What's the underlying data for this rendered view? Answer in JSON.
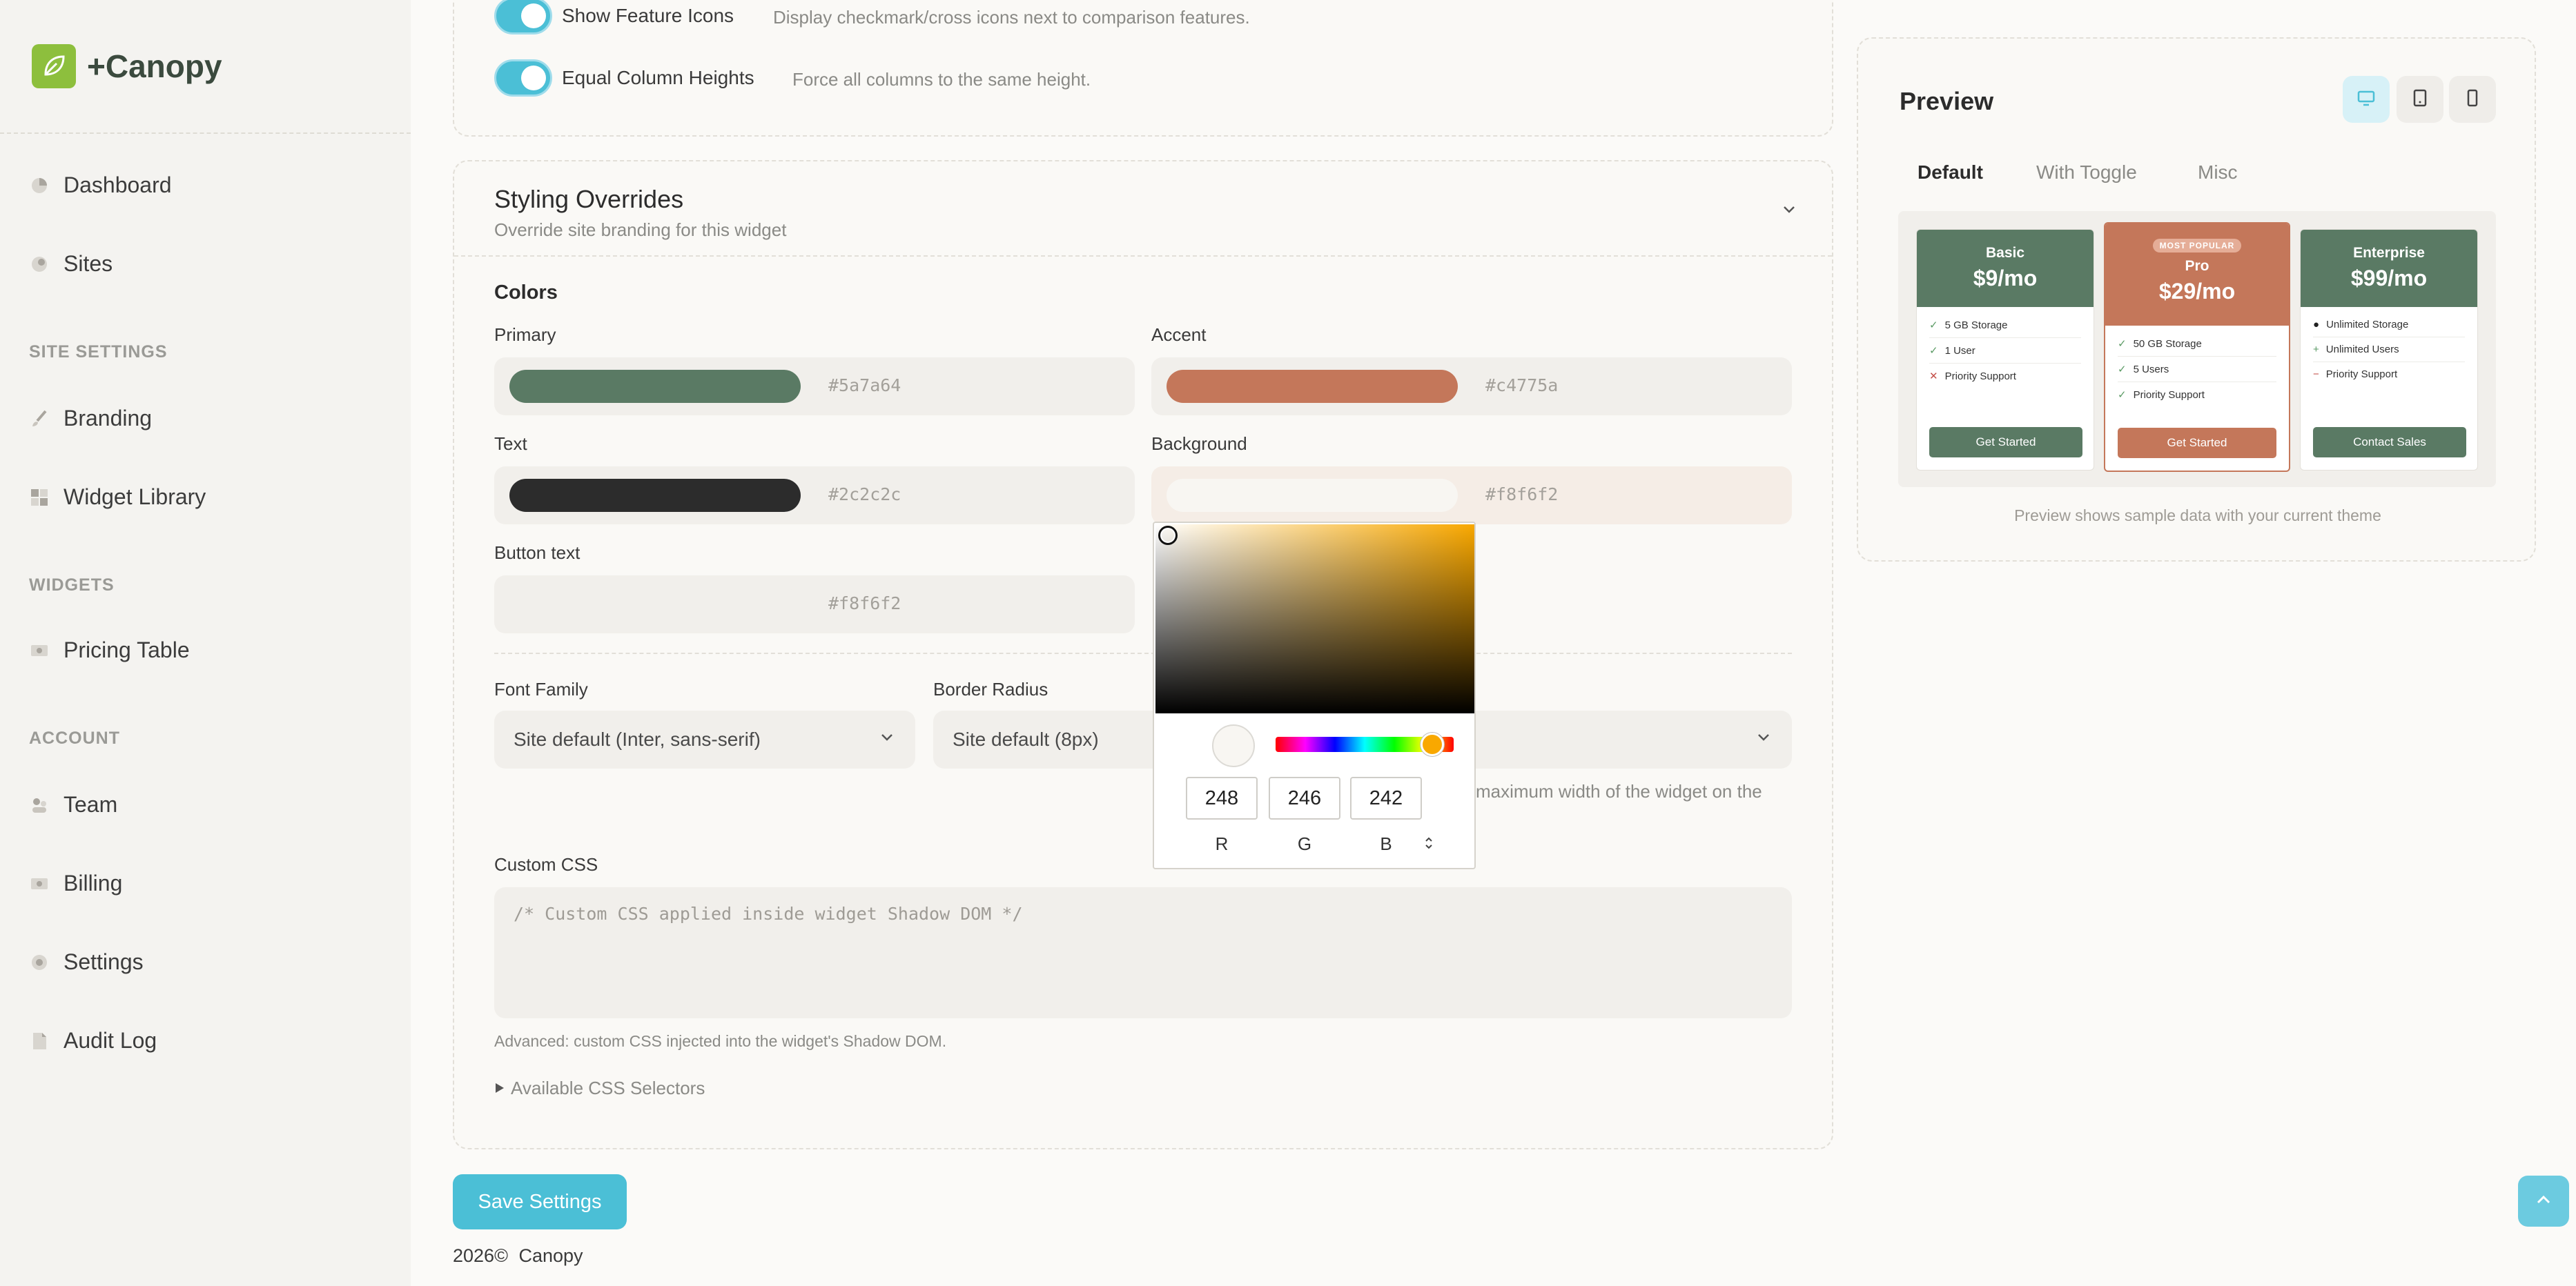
{
  "app": {
    "name": "+Canopy"
  },
  "sidebar": {
    "items": [
      {
        "label": "Dashboard"
      },
      {
        "label": "Sites"
      },
      {
        "label": "Branding"
      },
      {
        "label": "Widget Library"
      },
      {
        "label": "Pricing Table"
      },
      {
        "label": "Team"
      },
      {
        "label": "Billing"
      },
      {
        "label": "Settings"
      },
      {
        "label": "Audit Log"
      }
    ],
    "sections": [
      "SITE SETTINGS",
      "WIDGETS",
      "ACCOUNT"
    ]
  },
  "display_options": {
    "show_feature_icons": {
      "label": "Show Feature Icons",
      "desc": "Display checkmark/cross icons next to comparison features.",
      "on": true
    },
    "equal_column_heights": {
      "label": "Equal Column Heights",
      "desc": "Force all columns to the same height.",
      "on": true
    }
  },
  "styling": {
    "title": "Styling Overrides",
    "subtitle": "Override site branding for this widget",
    "colors_heading": "Colors",
    "primary": {
      "label": "Primary",
      "hex": "#5a7a64",
      "color": "#5a7a64"
    },
    "accent": {
      "label": "Accent",
      "hex": "#c4775a",
      "color": "#c4775a"
    },
    "text": {
      "label": "Text",
      "hex": "#2c2c2c",
      "color": "#2c2c2c"
    },
    "background": {
      "label": "Background",
      "hex": "#f8f6f2",
      "color": "#f8f6f2"
    },
    "button_text": {
      "label": "Button text",
      "hex": "#f8f6f2"
    },
    "font_family": {
      "label": "Font Family",
      "value": "Site default (Inter, sans-serif)"
    },
    "border_radius": {
      "label": "Border Radius",
      "value": "Site default (8px)"
    },
    "max_width_help": "maximum width of the widget on the",
    "custom_css": {
      "label": "Custom CSS",
      "placeholder": "/* Custom CSS applied inside widget Shadow DOM */",
      "help": "Advanced: custom CSS injected into the widget's Shadow DOM."
    },
    "css_selectors": "Available CSS Selectors"
  },
  "color_picker": {
    "r": "248",
    "g": "246",
    "b": "242",
    "r_label": "R",
    "g_label": "G",
    "b_label": "B"
  },
  "save_button": "Save Settings",
  "footer": {
    "year": "2026©",
    "name": "Canopy"
  },
  "preview": {
    "title": "Preview",
    "tabs": [
      "Default",
      "With Toggle",
      "Misc"
    ],
    "caption": "Preview shows sample data with your current theme",
    "plans": [
      {
        "name": "Basic",
        "price": "$9/mo",
        "features": [
          "5 GB Storage",
          "1 User",
          "Priority Support"
        ],
        "feature_icons": [
          "check",
          "check",
          "cross"
        ],
        "cta": "Get Started"
      },
      {
        "badge": "MOST POPULAR",
        "name": "Pro",
        "price": "$29/mo",
        "features": [
          "50 GB Storage",
          "5 Users",
          "Priority Support"
        ],
        "feature_icons": [
          "check",
          "check",
          "check"
        ],
        "cta": "Get Started"
      },
      {
        "name": "Enterprise",
        "price": "$99/mo",
        "features": [
          "Unlimited Storage",
          "Unlimited Users",
          "Priority Support"
        ],
        "feature_icons": [
          "bullet",
          "plus",
          "minus"
        ],
        "cta": "Contact Sales"
      }
    ]
  }
}
